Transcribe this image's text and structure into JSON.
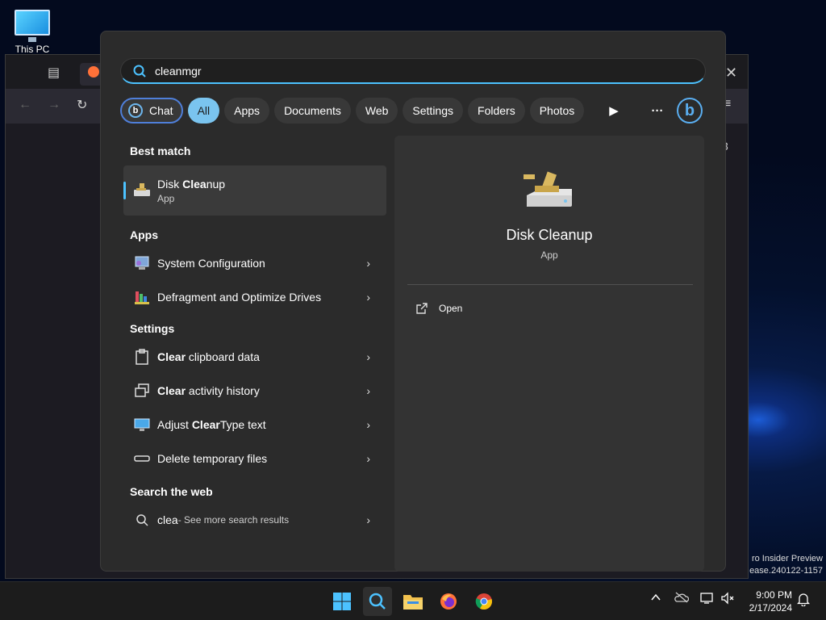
{
  "desktop": {
    "icon_label": "This PC"
  },
  "browser": {
    "badge": "3"
  },
  "watermark": {
    "line1": "ro Insider Preview",
    "line2": "ease.240122-1157"
  },
  "search": {
    "query": "cleanmgr"
  },
  "filters": [
    {
      "label": "Chat"
    },
    {
      "label": "All"
    },
    {
      "label": "Apps"
    },
    {
      "label": "Documents"
    },
    {
      "label": "Web"
    },
    {
      "label": "Settings"
    },
    {
      "label": "Folders"
    },
    {
      "label": "Photos"
    }
  ],
  "sections": {
    "best_match": "Best match",
    "apps": "Apps",
    "settings": "Settings",
    "web": "Search the web"
  },
  "best_match": {
    "title_bold": "Clea",
    "title_rest": "nup",
    "title_prefix": "Disk ",
    "subtitle": "App"
  },
  "apps": [
    {
      "label": "System Configuration"
    },
    {
      "label": "Defragment and Optimize Drives"
    }
  ],
  "settings": [
    {
      "bold": "Clear",
      "rest": " clipboard data",
      "prefix": ""
    },
    {
      "bold": "Clear",
      "rest": " activity history",
      "prefix": ""
    },
    {
      "bold": "Clear",
      "rest": "Type text",
      "prefix": "Adjust "
    },
    {
      "bold": "",
      "rest": "Delete temporary files",
      "prefix": ""
    }
  ],
  "web": {
    "query": "clea",
    "sub": " - See more search results"
  },
  "preview": {
    "title": "Disk Cleanup",
    "subtitle": "App",
    "action": "Open"
  },
  "clock": {
    "time": "9:00 PM",
    "date": "2/17/2024"
  },
  "colors": {
    "accent": "#4cc2ff",
    "all_chip": "#7ac4ef",
    "panel": "#2b2b2b"
  }
}
